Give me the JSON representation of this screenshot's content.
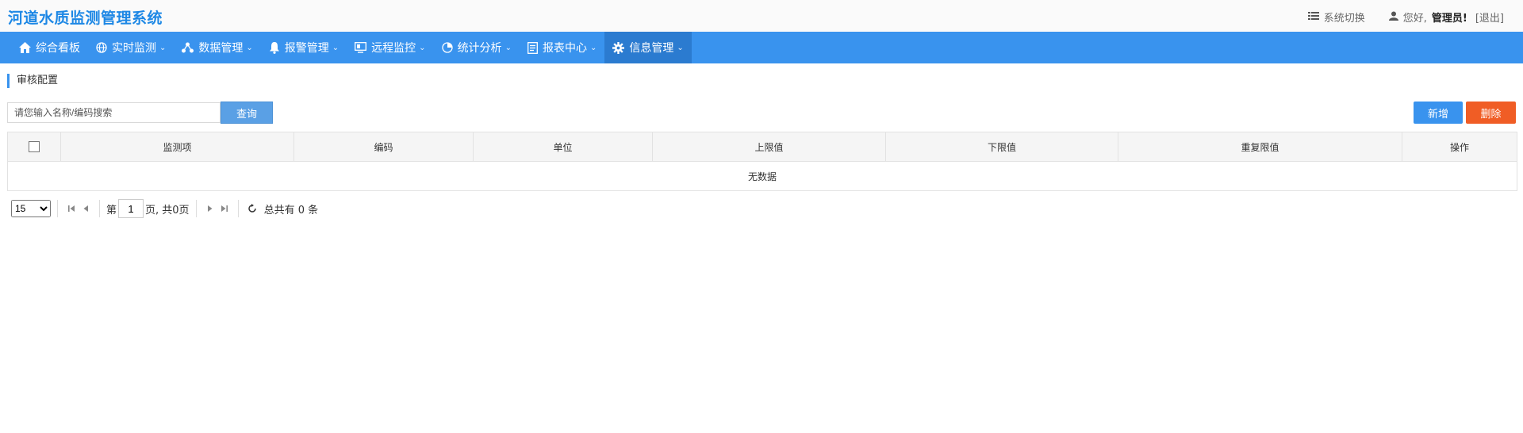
{
  "header": {
    "app_title": "河道水质监测管理系统",
    "switch_label": "系统切换",
    "greeting": "您好,",
    "user_name": "管理员!",
    "logout_label": "[退出]"
  },
  "nav": {
    "items": [
      {
        "label": "综合看板",
        "icon": "home-icon",
        "dropdown": false
      },
      {
        "label": "实时监测",
        "icon": "globe-icon",
        "dropdown": true
      },
      {
        "label": "数据管理",
        "icon": "share-nodes-icon",
        "dropdown": true
      },
      {
        "label": "报警管理",
        "icon": "bell-icon",
        "dropdown": true
      },
      {
        "label": "远程监控",
        "icon": "monitor-icon",
        "dropdown": true
      },
      {
        "label": "统计分析",
        "icon": "pie-chart-icon",
        "dropdown": true
      },
      {
        "label": "报表中心",
        "icon": "report-icon",
        "dropdown": true
      },
      {
        "label": "信息管理",
        "icon": "gear-icon",
        "dropdown": true,
        "active": true
      }
    ]
  },
  "page": {
    "title": "审核配置"
  },
  "search": {
    "placeholder": "请您输入名称/编码搜索",
    "value": "",
    "query_label": "查询"
  },
  "toolbar": {
    "add_label": "新增",
    "delete_label": "删除"
  },
  "table": {
    "columns": [
      "监测项",
      "编码",
      "单位",
      "上限值",
      "下限值",
      "重复限值",
      "操作"
    ],
    "rows": [],
    "empty_text": "无数据"
  },
  "pager": {
    "page_size": "15",
    "page_size_options": [
      "15"
    ],
    "prefix": "第",
    "current_page": "1",
    "suffix": "页, 共0页",
    "total_text": "总共有 0 条"
  },
  "colors": {
    "nav_bg": "#3993ee",
    "nav_active": "#2b7bd0",
    "logo": "#1e88e5",
    "add_button": "#3993ee",
    "delete_button": "#f05d25"
  }
}
